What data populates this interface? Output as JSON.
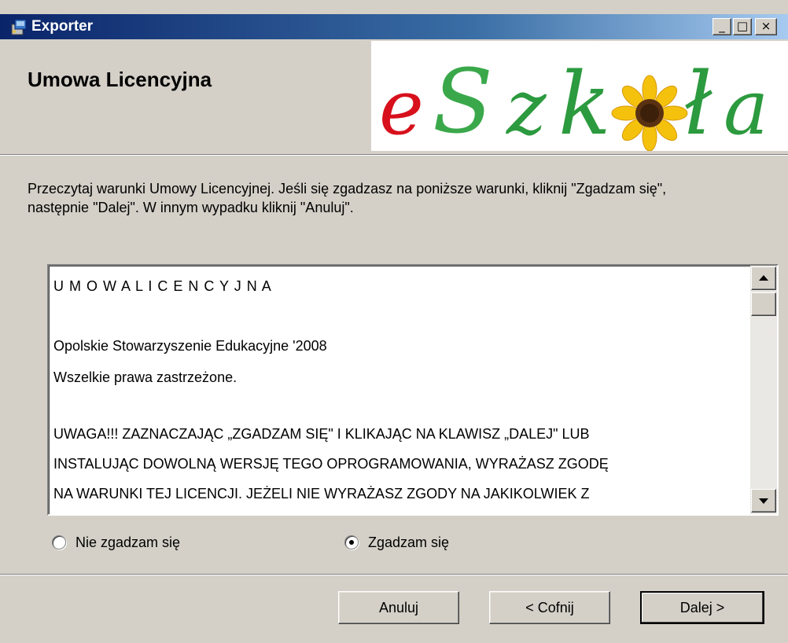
{
  "window": {
    "title": "Exporter"
  },
  "titlebar_buttons": {
    "minimize": "_",
    "maximize": "□",
    "close": "×"
  },
  "header": {
    "title": "Umowa Licencyjna",
    "logo_text": "eSzkoła"
  },
  "instruction": {
    "line1": "Przeczytaj warunki Umowy Licencyjnej. Jeśli się zgadzasz na poniższe warunki, kliknij \"Zgadzam się\",",
    "line2": "następnie \"Dalej\". W innym wypadku kliknij \"Anuluj\"."
  },
  "license": {
    "lines": [
      "U M O W A   L I C E N C Y J N A",
      "Opolskie Stowarzyszenie Edukacyjne '2008",
      "Wszelkie prawa zastrzeżone.",
      "UWAGA!!! ZAZNACZAJĄC „ZGADZAM SIĘ\" I KLIKAJĄC NA KLAWISZ „DALEJ\" LUB",
      "INSTALUJĄC DOWOLNĄ WERSJĘ TEGO OPROGRAMOWANIA, WYRAŻASZ ZGODĘ",
      "NA WARUNKI TEJ LICENCJI. JEŻELI NIE WYRAŻASZ ZGODY NA JAKIKOLWIEK Z"
    ]
  },
  "radios": {
    "decline": {
      "label": "Nie zgadzam się",
      "checked": false
    },
    "accept": {
      "label": "Zgadzam się",
      "checked": true
    }
  },
  "buttons": {
    "cancel": "Anuluj",
    "back": "< Cofnij",
    "next": "Dalej >"
  }
}
